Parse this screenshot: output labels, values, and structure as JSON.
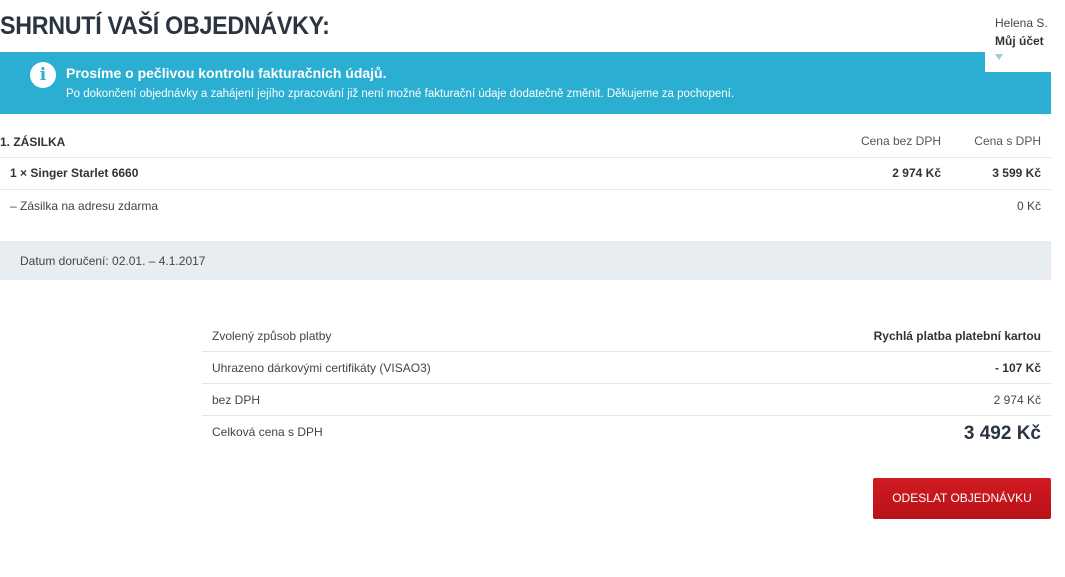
{
  "page": {
    "title": "SHRNUTÍ VAŠÍ OBJEDNÁVKY:"
  },
  "account": {
    "name": "Helena S.",
    "link_label": "Můj účet"
  },
  "notice": {
    "heading": "Prosíme o pečlivou kontrolu fakturačních údajů.",
    "text": "Po dokončení objednávky a zahájení jejího zpracování již není možné fakturační údaje dodatečně změnit. Děkujeme za pochopení.",
    "icon": "info-icon",
    "color": "#2aaed1"
  },
  "shipment": {
    "title": "1. ZÁSILKA",
    "col_net": "Cena bez DPH",
    "col_gross": "Cena s DPH",
    "item": {
      "name": "1 × Singer Starlet 6660",
      "net": "2 974 Kč",
      "gross": "3 599 Kč"
    },
    "shipping": {
      "name": "– Zásilka na adresu zdarma",
      "price": "0 Kč"
    },
    "delivery": "Datum doručení: 02.01. – 4.1.2017"
  },
  "summary": {
    "payment_label": "Zvolený způsob platby",
    "payment_value": "Rychlá platba platební kartou",
    "voucher_label": "Uhrazeno dárkovými certifikáty (VISAO3)",
    "voucher_value": "- 107 Kč",
    "net_label": "bez DPH",
    "net_value": "2 974 Kč",
    "total_label": "Celková cena s DPH",
    "total_value": "3 492 Kč"
  },
  "actions": {
    "submit_label": "ODESLAT OBJEDNÁVKU",
    "submit_color": "#c4161c"
  }
}
